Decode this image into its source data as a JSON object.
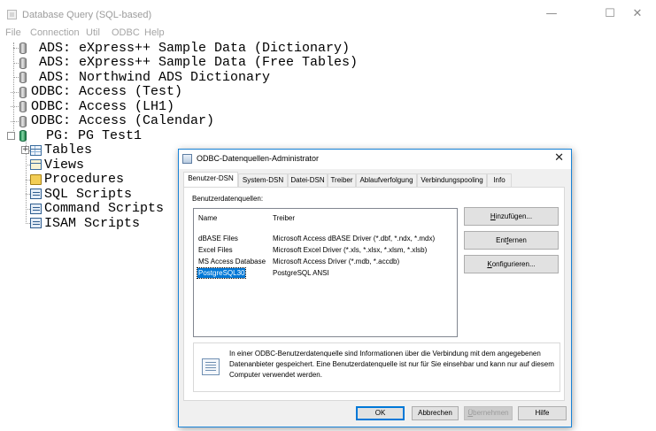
{
  "window": {
    "title": "Database Query (SQL-based)",
    "controls": {
      "minimize": "—",
      "maximize": "☐",
      "close": "✕"
    }
  },
  "menu": [
    "File",
    "Connection",
    "Util",
    "ODBC",
    "Help"
  ],
  "tree": {
    "connections": [
      "ADS: eXpress++ Sample Data (Dictionary)",
      "ADS: eXpress++ Sample Data (Free Tables)",
      "ADS: Northwind ADS Dictionary",
      "ODBC: Access (Test)",
      "ODBC: Access (LH1)",
      "ODBC: Access (Calendar)",
      "PG: PG Test1"
    ],
    "children": [
      "Tables",
      "Views",
      "Procedures",
      "SQL Scripts",
      "Command Scripts",
      "ISAM Scripts"
    ],
    "expander_symbol": "+"
  },
  "dialog": {
    "title": "ODBC-Datenquellen-Administrator",
    "close": "✕",
    "tabs": [
      "Benutzer-DSN",
      "System-DSN",
      "Datei-DSN",
      "Treiber",
      "Ablaufverfolgung",
      "Verbindungspooling",
      "Info"
    ],
    "active_tab": "Benutzer-DSN",
    "section_label": "Benutzerdatenquellen:",
    "columns": {
      "name": "Name",
      "driver": "Treiber"
    },
    "rows": [
      {
        "name": "dBASE Files",
        "driver": "Microsoft Access dBASE Driver (*.dbf, *.ndx, *.mdx)"
      },
      {
        "name": "Excel Files",
        "driver": "Microsoft Excel Driver (*.xls, *.xlsx, *.xlsm, *.xlsb)"
      },
      {
        "name": "MS Access Database",
        "driver": "Microsoft Access Driver (*.mdb, *.accdb)"
      },
      {
        "name": "PostgreSQL30",
        "driver": "PostgreSQL ANSI"
      }
    ],
    "selected_row": "PostgreSQL30",
    "side_buttons": {
      "add": {
        "pre": "",
        "key": "H",
        "post": "inzufügen..."
      },
      "remove": {
        "pre": "Ent",
        "key": "f",
        "post": "ernen"
      },
      "configure": {
        "pre": "",
        "key": "K",
        "post": "onfigurieren..."
      }
    },
    "info_text": "In einer ODBC-Benutzerdatenquelle sind Informationen über die Verbindung mit dem angegebenen Datenanbieter gespeichert. Eine Benutzerdatenquelle ist nur für Sie einsehbar und kann nur auf diesem Computer verwendet werden.",
    "bottom_buttons": {
      "ok": "OK",
      "cancel": "Abbrechen",
      "apply": {
        "pre": "",
        "key": "Ü",
        "post": "bernehmen"
      },
      "help": "Hilfe"
    }
  },
  "colors": {
    "selection": "#0078d7",
    "dialog_border": "#1883d7",
    "pg_icon": "#1f8f55"
  },
  "icons": {
    "connection": "database-cylinder-icon",
    "tables": "table-icon",
    "views": "view-icon",
    "procedures": "folder-icon",
    "scripts": "script-icon",
    "info": "data-source-info-icon"
  }
}
